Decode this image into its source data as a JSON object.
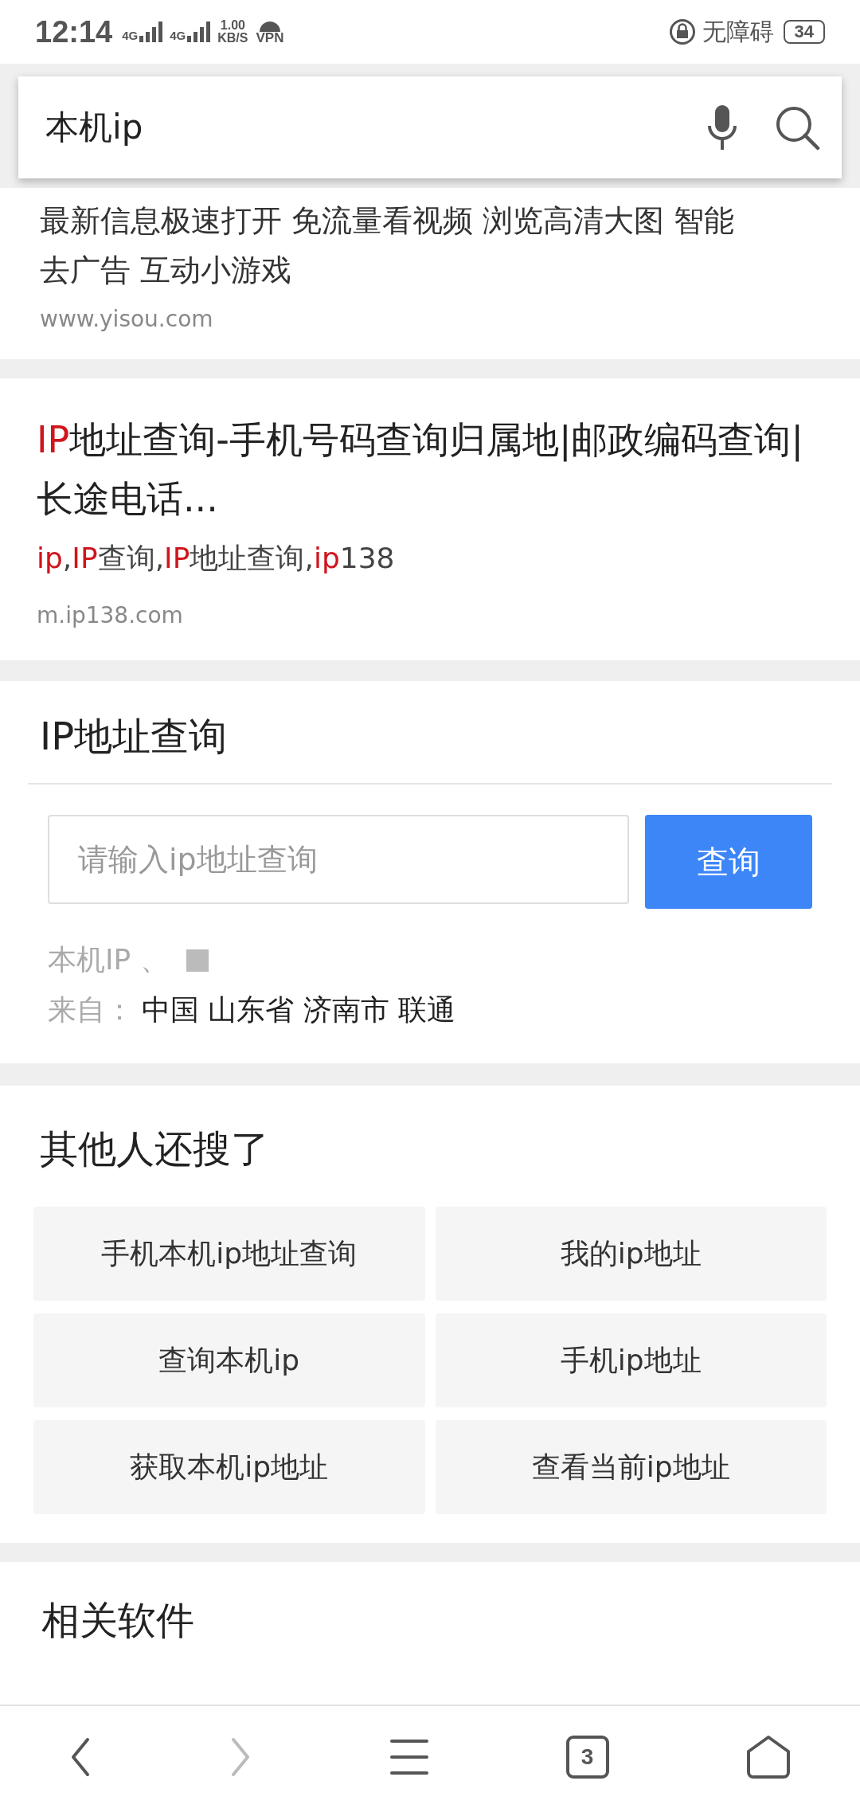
{
  "status_bar": {
    "time": "12:14",
    "network_1": "4G",
    "network_2": "4G",
    "speed_value": "1.00",
    "speed_unit": "KB/S",
    "vpn": "VPN",
    "accessibility": "无障碍",
    "battery": "34"
  },
  "search": {
    "query": "本机ip"
  },
  "results": [
    {
      "snippet": "最新信息极速打开 免流量看视频 浏览高清大图 智能去广告 互动小游戏",
      "url": "www.yisou.com"
    },
    {
      "title": [
        {
          "text": "IP",
          "highlight": true
        },
        {
          "text": "地址查询-手机号码查询归属地|邮政编码查询|长途电话...",
          "highlight": false
        }
      ],
      "keywords": [
        {
          "text": "ip",
          "highlight": true
        },
        {
          "text": ",",
          "highlight": false
        },
        {
          "text": "IP",
          "highlight": true
        },
        {
          "text": "查询,",
          "highlight": false
        },
        {
          "text": "IP",
          "highlight": true
        },
        {
          "text": "地址查询,",
          "highlight": false
        },
        {
          "text": "ip",
          "highlight": true
        },
        {
          "text": "138",
          "highlight": false
        }
      ],
      "url": "m.ip138.com"
    }
  ],
  "ip_tool": {
    "title": "IP地址查询",
    "placeholder": "请输入ip地址查询",
    "button": "查询",
    "ip_label": "本机IP 、",
    "from_label": "来自：",
    "location": "中国 山东省 济南市 联通"
  },
  "others": {
    "title": "其他人还搜了",
    "items": [
      "手机本机ip地址查询",
      "我的ip地址",
      "查询本机ip",
      "手机ip地址",
      "获取本机ip地址",
      "查看当前ip地址"
    ]
  },
  "related": {
    "title": "相关软件"
  },
  "bottom_nav": {
    "back_disabled": false,
    "forward_disabled": true,
    "tabs_count": "3"
  }
}
